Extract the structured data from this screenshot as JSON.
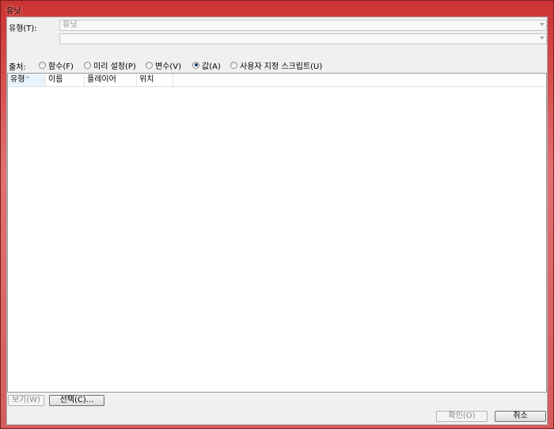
{
  "window": {
    "title": "유닛"
  },
  "type_field": {
    "label": "유형(T):",
    "primary_value": "유닛",
    "secondary_value": ""
  },
  "source": {
    "label": "출처:",
    "options": [
      {
        "label": "함수(F)",
        "checked": false
      },
      {
        "label": "미리 설정(P)",
        "checked": false
      },
      {
        "label": "변수(V)",
        "checked": false
      },
      {
        "label": "값(A)",
        "checked": true
      },
      {
        "label": "사용자 지정 스크립트(U)",
        "checked": false
      }
    ]
  },
  "list": {
    "columns": [
      "유형",
      "이름",
      "플레이어",
      "위치"
    ],
    "sorted_column": "유형",
    "rows": []
  },
  "buttons": {
    "view": "보기(W)",
    "select": "선택(C)...",
    "ok": "확인(O)",
    "cancel": "취소"
  },
  "colors": {
    "title_bar": "#d9534f",
    "client_bg": "#f0f0f0",
    "sort_highlight": "#e9f3fb"
  }
}
